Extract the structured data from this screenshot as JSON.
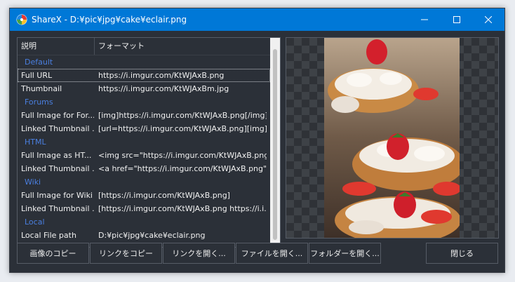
{
  "window": {
    "title": "ShareX - D:¥pic¥jpg¥cake¥eclair.png"
  },
  "list": {
    "columns": [
      "説明",
      "フォーマット"
    ],
    "groups": [
      {
        "name": "Default",
        "items": [
          {
            "desc": "Full URL",
            "format": "https://i.imgur.com/KtWJAxB.png",
            "selected": true
          },
          {
            "desc": "Thumbnail",
            "format": "https://i.imgur.com/KtWJAxBm.jpg"
          }
        ]
      },
      {
        "name": "Forums",
        "items": [
          {
            "desc": "Full Image for For...",
            "format": "[img]https://i.imgur.com/KtWJAxB.png[/img]"
          },
          {
            "desc": "Linked Thumbnail ...",
            "format": "[url=https://i.imgur.com/KtWJAxB.png][img]..."
          }
        ]
      },
      {
        "name": "HTML",
        "items": [
          {
            "desc": "Full Image as HT...",
            "format": "<img src=\"https://i.imgur.com/KtWJAxB.png..."
          },
          {
            "desc": "Linked Thumbnail ...",
            "format": "<a href=\"https://i.imgur.com/KtWJAxB.png\" ..."
          }
        ]
      },
      {
        "name": "Wiki",
        "items": [
          {
            "desc": "Full Image for Wiki",
            "format": "[https://i.imgur.com/KtWJAxB.png]"
          },
          {
            "desc": "Linked Thumbnail ...",
            "format": "[https://i.imgur.com/KtWJAxB.png https://i.i..."
          }
        ]
      },
      {
        "name": "Local",
        "items": [
          {
            "desc": "Local File path",
            "format": "D:¥pic¥jpg¥cake¥eclair.png"
          }
        ]
      }
    ]
  },
  "buttons": {
    "copy_image": "画像のコピー",
    "copy_link": "リンクをコピー",
    "open_link": "リンクを開く...",
    "open_file": "ファイルを開く...",
    "open_folder": "フォルダーを開く...",
    "close": "閉じる"
  },
  "colors": {
    "titlebar": "#0078d7",
    "background": "#2b3038",
    "group_text": "#4a7fe0"
  }
}
